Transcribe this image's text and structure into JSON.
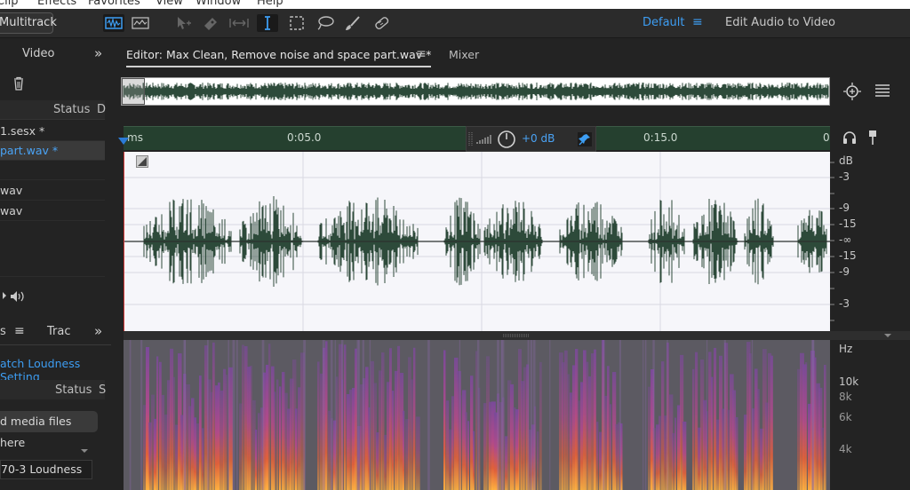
{
  "menubar": {
    "items": [
      "Clip",
      "Effects",
      "Favorites",
      "View",
      "Window",
      "Help"
    ]
  },
  "toolbar": {
    "multitrack_label": "Multitrack",
    "tools": [
      "waveform-view-icon",
      "spectral-view-icon",
      "move-tool-icon",
      "razor-tool-icon",
      "slip-tool-icon",
      "time-selection-icon",
      "marquee-icon",
      "lasso-icon",
      "brush-icon",
      "spot-healing-icon"
    ],
    "workspace_default": "Default",
    "workspace_menu": "≡",
    "edit_audio_to_video": "Edit Audio to Video"
  },
  "files_panel": {
    "tab_label": "Video",
    "expand_glyph": "»",
    "status_header": "Status",
    "d_header": "D",
    "items": [
      "1.sesx *",
      "part.wav *",
      "",
      "wav",
      "wav"
    ]
  },
  "lower_panel": {
    "tab_s": "s",
    "tab_menu": "≡",
    "tab_trac": "Trac",
    "expand_glyph": "»",
    "match_loudness": "atch Loudness Setting",
    "status_header": "Status",
    "s_header": "S",
    "drop_hint": "d media files here",
    "preset": "70-3 Loudness"
  },
  "editor": {
    "tab_label": "Editor: Max Clean, Remove noise and space part.wav *",
    "tab_menu": "≡",
    "mixer_label": "Mixer"
  },
  "ruler": {
    "labels": [
      "ms",
      "0:05.0",
      "0:15.0",
      "0"
    ],
    "volume_db": "+0 dB"
  },
  "db_scale": [
    "dB",
    "-3",
    "-9",
    "-15",
    "-∞",
    "-15",
    "-9",
    "-3"
  ],
  "hz_scale": [
    "Hz",
    "10k",
    "8k",
    "6k",
    "4k"
  ],
  "colors": {
    "accent": "#3d9df2",
    "waveform": "#2d4a3a",
    "ruler_bg": "#25402f",
    "selection_line": "#d23a3a"
  }
}
